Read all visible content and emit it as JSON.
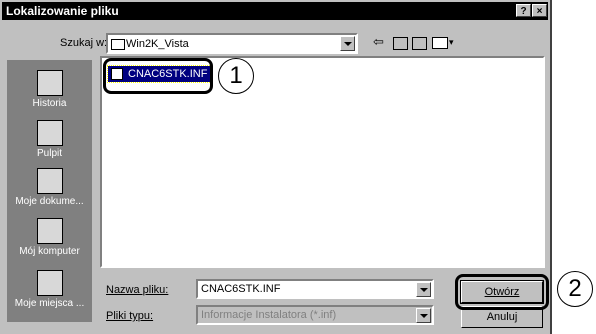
{
  "window": {
    "title": "Lokalizowanie pliku",
    "help_glyph": "?",
    "close_glyph": "×"
  },
  "lookin": {
    "label": "Szukaj w:",
    "value": "Win2K_Vista"
  },
  "toolbar": {
    "icons": [
      "back-icon",
      "up-folder-icon",
      "new-folder-icon",
      "view-menu-icon"
    ]
  },
  "places": [
    {
      "label": "Historia",
      "icon": "history-icon"
    },
    {
      "label": "Pulpit",
      "icon": "desktop-icon"
    },
    {
      "label": "Moje dokume...",
      "icon": "my-documents-icon"
    },
    {
      "label": "Mój komputer",
      "icon": "my-computer-icon"
    },
    {
      "label": "Moje miejsca ...",
      "icon": "network-places-icon"
    }
  ],
  "files": [
    {
      "name": "CNAC6STK.INF",
      "selected": true
    }
  ],
  "filename": {
    "label": "Nazwa pliku:",
    "value": "CNAC6STK.INF"
  },
  "filetype": {
    "label": "Pliki typu:",
    "value": "Informacje Instalatora (*.inf)"
  },
  "buttons": {
    "open": "Otwórz",
    "cancel": "Anuluj"
  },
  "callouts": {
    "one": "1",
    "two": "2"
  }
}
